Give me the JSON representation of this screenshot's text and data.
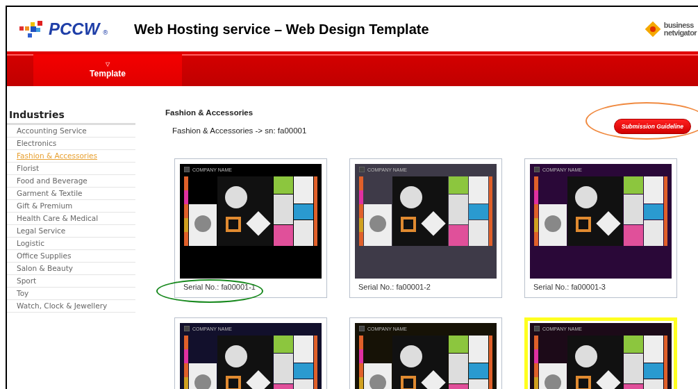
{
  "header": {
    "brand": "PCCW",
    "brand_mark": "®",
    "title": "Web Hosting service – Web Design Template",
    "partner_logo": [
      "business",
      "netvigator"
    ]
  },
  "nav": {
    "tabs": [
      {
        "label": "Template",
        "marker": "▽",
        "selected": true
      }
    ]
  },
  "sidebar": {
    "title": "Industries",
    "items": [
      {
        "label": "Accounting Service",
        "selected": false
      },
      {
        "label": "Electronics",
        "selected": false
      },
      {
        "label": "Fashion & Accessories",
        "selected": true
      },
      {
        "label": "Florist",
        "selected": false
      },
      {
        "label": "Food and Beverage",
        "selected": false
      },
      {
        "label": "Garment & Textile",
        "selected": false
      },
      {
        "label": "Gift & Premium",
        "selected": false
      },
      {
        "label": "Health Care & Medical",
        "selected": false
      },
      {
        "label": "Legal Service",
        "selected": false
      },
      {
        "label": "Logistic",
        "selected": false
      },
      {
        "label": "Office Supplies",
        "selected": false
      },
      {
        "label": "Salon & Beauty",
        "selected": false
      },
      {
        "label": "Sport",
        "selected": false
      },
      {
        "label": "Toy",
        "selected": false
      },
      {
        "label": "Watch, Clock & Jewellery",
        "selected": false
      }
    ]
  },
  "main": {
    "heading": "Fashion & Accessories",
    "breadcrumb": "Fashion & Accessories -> sn: fa00001",
    "submit_button": {
      "label": "Submission Guideline",
      "circled": true
    },
    "templates": [
      {
        "preview_title": "COMPANY NAME",
        "serial": "Serial No.: fa00001-1",
        "color": "#000000",
        "selected": false,
        "circled": true
      },
      {
        "preview_title": "COMPANY NAME",
        "serial": "Serial No.: fa00001-2",
        "color": "#3e3a48",
        "selected": false,
        "circled": false
      },
      {
        "preview_title": "COMPANY NAME",
        "serial": "Serial No.: fa00001-3",
        "color": "#2a0838",
        "selected": false,
        "circled": false
      },
      {
        "preview_title": "COMPANY NAME",
        "color": "#12102c",
        "selected": false,
        "circled": false
      },
      {
        "preview_title": "COMPANY NAME",
        "color": "#161206",
        "selected": false,
        "circled": false
      },
      {
        "preview_title": "COMPANY NAME",
        "color": "#1c0a18",
        "selected": true,
        "circled": false
      }
    ]
  }
}
